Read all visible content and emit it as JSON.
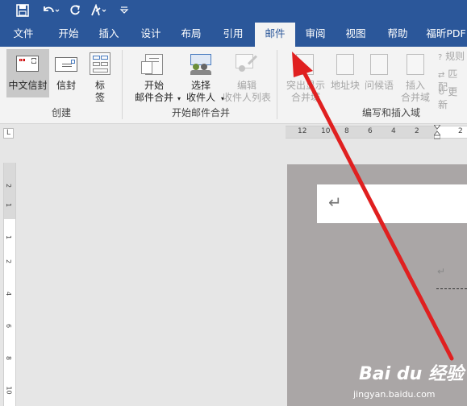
{
  "qat": {
    "save_icon": "save-icon",
    "undo_icon": "undo-icon",
    "redo_icon": "redo-icon",
    "format_icon": "format-painter-icon",
    "customize_icon": "customize-icon"
  },
  "tabs": [
    {
      "label": "文件"
    },
    {
      "label": "开始"
    },
    {
      "label": "插入"
    },
    {
      "label": "设计"
    },
    {
      "label": "布局"
    },
    {
      "label": "引用"
    },
    {
      "label": "邮件"
    },
    {
      "label": "审阅"
    },
    {
      "label": "视图"
    },
    {
      "label": "帮助"
    },
    {
      "label": "福昕PDF"
    }
  ],
  "active_tab": "邮件",
  "ribbon": {
    "create": {
      "group": "创建",
      "chinese_envelope": "中文信封",
      "envelope": "信封",
      "label_line1": "标",
      "label_line2": "签"
    },
    "merge": {
      "group": "开始邮件合并",
      "start_line1": "开始",
      "start_line2": "邮件合并",
      "select_line1": "选择",
      "select_line2": "收件人",
      "edit_line1": "编辑",
      "edit_line2": "收件人列表"
    },
    "write": {
      "group": "编写和插入域",
      "highlight_line1": "突出显示",
      "highlight_line2": "合并域",
      "address_block": "地址块",
      "greeting": "问候语",
      "insert_line1": "插入",
      "insert_line2": "合并域",
      "rules": "规则",
      "match": "匹配",
      "update": "更新"
    }
  },
  "ruler": {
    "tab_selector": "L",
    "h_numbers": [
      "12",
      "10",
      "8",
      "6",
      "4",
      "2",
      "2"
    ],
    "v_numbers": [
      "2",
      "1",
      "1",
      "2",
      "4",
      "6",
      "8",
      "10"
    ]
  },
  "document": {
    "return_mark": "↵",
    "return_mark_small": "↵"
  },
  "watermark": {
    "brand": "Bai du 经验",
    "url": "jingyan.baidu.com"
  },
  "colors": {
    "ribbon_blue": "#2b579a",
    "arrow_red": "#e02020"
  }
}
